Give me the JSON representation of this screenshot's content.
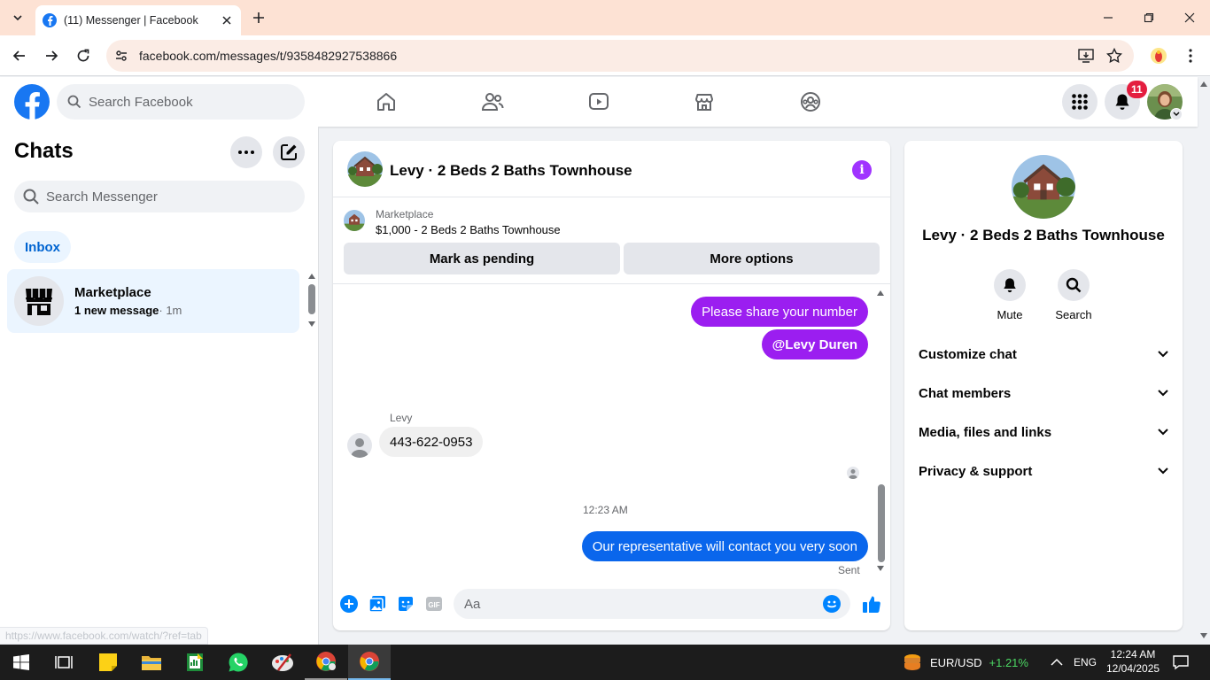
{
  "browser": {
    "tab_title": "(11) Messenger | Facebook",
    "url": "facebook.com/messages/t/9358482927538866",
    "status_url": "https://www.facebook.com/watch/?ref=tab"
  },
  "fb": {
    "search_placeholder": "Search Facebook",
    "notification_count": "11",
    "brand_color": "#1877f2"
  },
  "sidebar": {
    "title": "Chats",
    "search_placeholder": "Search Messenger",
    "filter_label": "Inbox",
    "chats": [
      {
        "name": "Marketplace",
        "preview": "1 new message",
        "time": "· 1m"
      }
    ]
  },
  "conversation": {
    "title": "Levy · 2 Beds 2 Baths Townhouse",
    "marketplace_label": "Marketplace",
    "listing": "$1,000 - 2 Beds 2 Baths Townhouse",
    "mark_pending_label": "Mark as pending",
    "more_options_label": "More options",
    "messages": [
      {
        "from": "me",
        "text": "Please share your number"
      },
      {
        "from": "me",
        "text": "@Levy Duren"
      },
      {
        "from": "Levy",
        "text": "443-622-0953"
      },
      {
        "from": "me",
        "text": "Our representative will contact you very soon"
      }
    ],
    "sender_name": "Levy",
    "timestamp": "12:23 AM",
    "sent_label": "Sent",
    "composer_placeholder": "Aa"
  },
  "info_panel": {
    "name": "Levy · 2 Beds 2 Baths Townhouse",
    "mute_label": "Mute",
    "search_label": "Search",
    "sections": [
      "Customize chat",
      "Chat members",
      "Media, files and links",
      "Privacy & support"
    ]
  },
  "taskbar": {
    "ticker_symbol": "EUR/USD",
    "ticker_change": "+1.21%",
    "language": "ENG",
    "time": "12:24 AM",
    "date": "12/04/2025"
  },
  "colors": {
    "my_bubble_purple": "#9b1ef0",
    "my_bubble_blue": "#0a66ec",
    "accent_blue": "#0084ff"
  }
}
